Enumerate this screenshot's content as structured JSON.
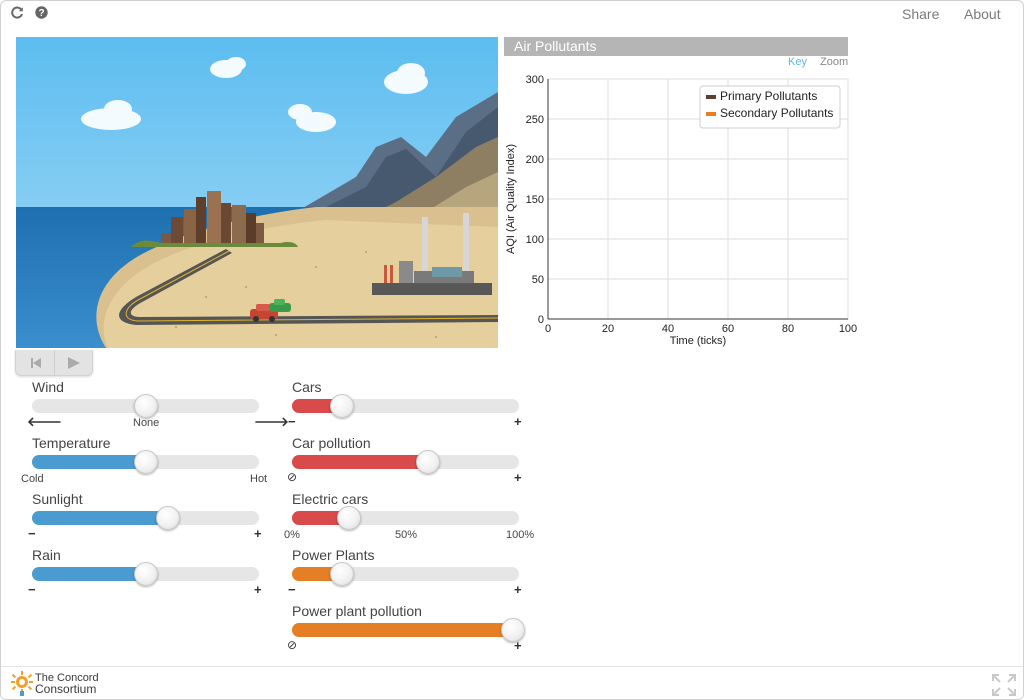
{
  "header": {
    "reload_icon": "reload-icon",
    "help_icon": "help-icon",
    "share_label": "Share",
    "about_label": "About"
  },
  "graph": {
    "title": "Air Pollutants",
    "key_label": "Key",
    "zoom_label": "Zoom"
  },
  "chart_data": {
    "type": "line",
    "title": "",
    "xlabel": "Time (ticks)",
    "ylabel": "AQI (Air Quality Index)",
    "xlim": [
      0,
      100
    ],
    "ylim": [
      0,
      300
    ],
    "xticks": [
      0,
      20,
      40,
      60,
      80,
      100
    ],
    "yticks": [
      0,
      50,
      100,
      150,
      200,
      250,
      300
    ],
    "grid": true,
    "legend_position": "top-right",
    "series": [
      {
        "name": "Primary Pollutants",
        "color": "#5a4030",
        "values": []
      },
      {
        "name": "Secondary Pollutants",
        "color": "#e87e22",
        "values": []
      }
    ]
  },
  "colors": {
    "blue_fill": "#4a9bd0",
    "red_fill": "#d94a4a",
    "orange_fill": "#e57f25",
    "header_gray": "#b5b5b5",
    "link_blue": "#5bb8e6"
  },
  "controls": {
    "wind": {
      "label": "Wind",
      "value_fraction": 0.5,
      "center_label": "None",
      "left_icon": "arrow-left-icon",
      "right_icon": "arrow-right-icon"
    },
    "temperature": {
      "label": "Temperature",
      "value_fraction": 0.5,
      "min_label": "Cold",
      "max_label": "Hot"
    },
    "sunlight": {
      "label": "Sunlight",
      "value_fraction": 0.6,
      "minus_icon": "minus-icon",
      "plus_icon": "plus-icon"
    },
    "rain": {
      "label": "Rain",
      "value_fraction": 0.5,
      "minus_icon": "minus-icon",
      "plus_icon": "plus-icon"
    },
    "cars": {
      "label": "Cars",
      "value_fraction": 0.22,
      "minus_icon": "minus-icon",
      "plus_icon": "plus-icon"
    },
    "car_pollution": {
      "label": "Car pollution",
      "value_fraction": 0.6,
      "min_icon": "none-icon",
      "plus_icon": "plus-icon"
    },
    "electric_cars": {
      "label": "Electric cars",
      "value_fraction": 0.25,
      "min_label": "0%",
      "mid_label": "50%",
      "max_label": "100%"
    },
    "power_plants": {
      "label": "Power Plants",
      "value_fraction": 0.22,
      "minus_icon": "minus-icon",
      "plus_icon": "plus-icon"
    },
    "power_plant_pollution": {
      "label": "Power plant pollution",
      "value_fraction": 1.0,
      "min_icon": "none-icon",
      "plus_icon": "plus-icon"
    }
  },
  "footer": {
    "logo_line1": "The Concord",
    "logo_line2": "Consortium"
  }
}
